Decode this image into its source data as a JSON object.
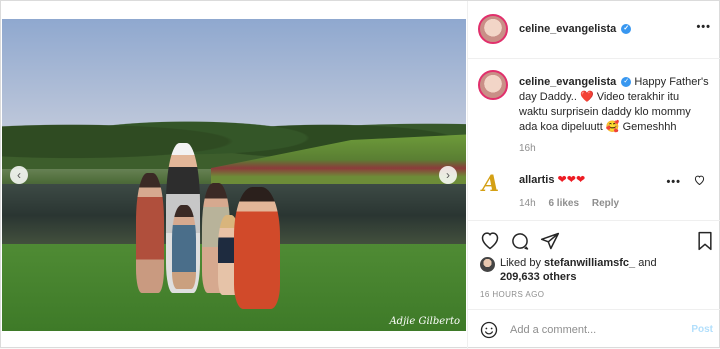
{
  "post": {
    "watermark": "Adjie Gilberto",
    "carousel": {
      "slide_count": 10,
      "active_index": 0
    }
  },
  "header": {
    "username": "celine_evangelista",
    "verified_icon": "verified-check-icon",
    "more_label": "•••"
  },
  "caption": {
    "username": "celine_evangelista",
    "part1": "Happy Father's day Daddy..",
    "heart": "❤️",
    "part2": "Video terakhir itu waktu surprisein daddy klo mommy ada koa dipeluutt",
    "emoji": "🥰",
    "part3": "Gemeshhh",
    "time": "16h"
  },
  "comment": {
    "username": "allartis",
    "text": "❤❤❤",
    "time": "14h",
    "likes": "6 likes",
    "reply": "Reply",
    "more_label": "•••"
  },
  "likes": {
    "prefix": "Liked by",
    "user": "stefanwilliamsfc_",
    "and": "and",
    "count": "209,633 others"
  },
  "timestamp": "16 HOURS AGO",
  "add_comment": {
    "placeholder": "Add a comment...",
    "post_label": "Post"
  },
  "colors": {
    "accent": "#3897f0",
    "post_disabled": "#b2dffc",
    "heart": "#ed1c24"
  }
}
